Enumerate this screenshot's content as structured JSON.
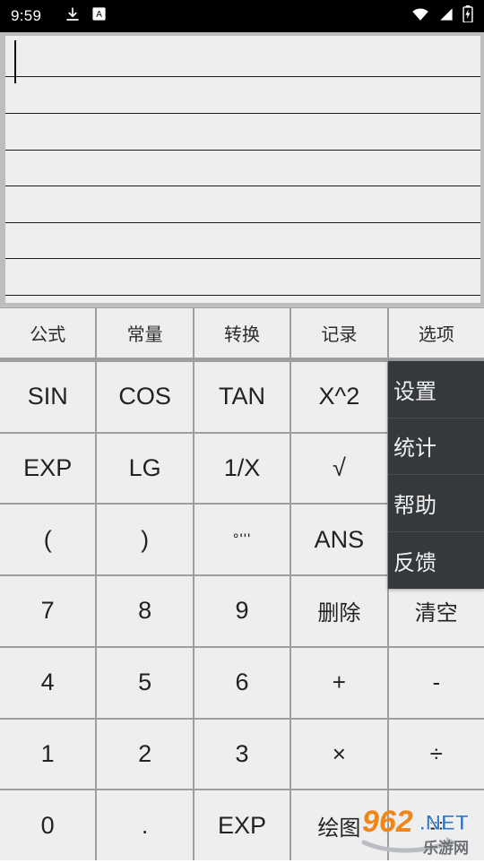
{
  "status_bar": {
    "time": "9:59",
    "left_icons": [
      "download-icon",
      "a-badge-icon"
    ],
    "right_icons": [
      "wifi-icon",
      "cell-signal-icon",
      "battery-charging-icon"
    ],
    "background": "#000000",
    "foreground": "#ffffff"
  },
  "display": {
    "expression": "",
    "placeholder": "",
    "line_count": 8,
    "background": "#eeeeee",
    "rule_color": "#1a1a1a",
    "caret_visible": true
  },
  "tabs": [
    {
      "label": "公式",
      "name": "tab-formula",
      "selected": false
    },
    {
      "label": "常量",
      "name": "tab-constant",
      "selected": false
    },
    {
      "label": "转换",
      "name": "tab-convert",
      "selected": false
    },
    {
      "label": "记录",
      "name": "tab-history",
      "selected": false
    },
    {
      "label": "选项",
      "name": "tab-options",
      "selected": true
    }
  ],
  "keypad": {
    "rows": [
      [
        {
          "label": "SIN",
          "name": "key-sin",
          "kind": "func"
        },
        {
          "label": "COS",
          "name": "key-cos",
          "kind": "func"
        },
        {
          "label": "TAN",
          "name": "key-tan",
          "kind": "func"
        },
        {
          "label": "X^2",
          "name": "key-square",
          "kind": "func"
        },
        {
          "label": "",
          "name": "key-blank-r1c5",
          "kind": "hidden"
        }
      ],
      [
        {
          "label": "EXP",
          "name": "key-exp-func",
          "kind": "func"
        },
        {
          "label": "LG",
          "name": "key-lg",
          "kind": "func"
        },
        {
          "label": "1/X",
          "name": "key-reciprocal",
          "kind": "func"
        },
        {
          "label": "√",
          "name": "key-sqrt",
          "kind": "func"
        },
        {
          "label": "",
          "name": "key-blank-r2c5",
          "kind": "hidden"
        }
      ],
      [
        {
          "label": "(",
          "name": "key-paren-open",
          "kind": "func"
        },
        {
          "label": ")",
          "name": "key-paren-close",
          "kind": "func"
        },
        {
          "label": "°'''",
          "name": "key-dms",
          "kind": "small"
        },
        {
          "label": "ANS",
          "name": "key-ans",
          "kind": "func"
        },
        {
          "label": "",
          "name": "key-blank-r3c5",
          "kind": "hidden"
        }
      ],
      [
        {
          "label": "7",
          "name": "key-7",
          "kind": "digit"
        },
        {
          "label": "8",
          "name": "key-8",
          "kind": "digit"
        },
        {
          "label": "9",
          "name": "key-9",
          "kind": "digit"
        },
        {
          "label": "删除",
          "name": "key-delete",
          "kind": "cjk"
        },
        {
          "label": "清空",
          "name": "key-clear",
          "kind": "cjk"
        }
      ],
      [
        {
          "label": "4",
          "name": "key-4",
          "kind": "digit"
        },
        {
          "label": "5",
          "name": "key-5",
          "kind": "digit"
        },
        {
          "label": "6",
          "name": "key-6",
          "kind": "digit"
        },
        {
          "label": "+",
          "name": "key-plus",
          "kind": "op"
        },
        {
          "label": "-",
          "name": "key-minus",
          "kind": "op"
        }
      ],
      [
        {
          "label": "1",
          "name": "key-1",
          "kind": "digit"
        },
        {
          "label": "2",
          "name": "key-2",
          "kind": "digit"
        },
        {
          "label": "3",
          "name": "key-3",
          "kind": "digit"
        },
        {
          "label": "×",
          "name": "key-multiply",
          "kind": "op"
        },
        {
          "label": "÷",
          "name": "key-divide",
          "kind": "op"
        }
      ],
      [
        {
          "label": "0",
          "name": "key-0",
          "kind": "digit"
        },
        {
          "label": ".",
          "name": "key-dot",
          "kind": "digit"
        },
        {
          "label": "EXP",
          "name": "key-exp",
          "kind": "func"
        },
        {
          "label": "绘图",
          "name": "key-plot",
          "kind": "cjk"
        },
        {
          "label": "=",
          "name": "key-equals",
          "kind": "op"
        }
      ]
    ]
  },
  "options_menu": {
    "open": true,
    "background": "#36393c",
    "text_color": "#f2f2f2",
    "items": [
      {
        "label": "设置",
        "name": "menu-item-settings"
      },
      {
        "label": "统计",
        "name": "menu-item-statistics"
      },
      {
        "label": "帮助",
        "name": "menu-item-help"
      },
      {
        "label": "反馈",
        "name": "menu-item-feedback"
      }
    ]
  },
  "watermark": {
    "number": "962",
    "domain": ".NET",
    "chinese": "乐游网",
    "number_color": "#f08518",
    "domain_color": "#3b78c2"
  },
  "theme": {
    "key_background": "#eeeeee",
    "frame": "#9e9e9e",
    "text": "#222222"
  }
}
